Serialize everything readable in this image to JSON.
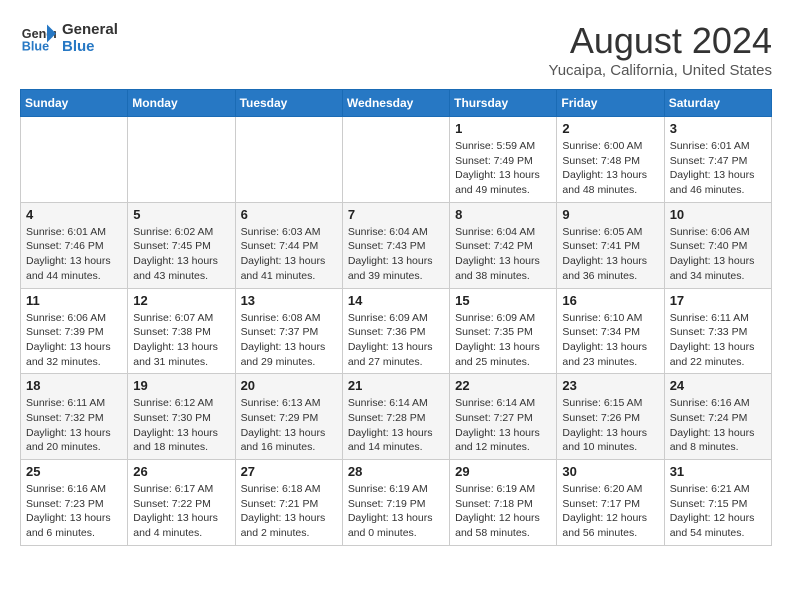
{
  "logo": {
    "line1": "General",
    "line2": "Blue"
  },
  "title": "August 2024",
  "subtitle": "Yucaipa, California, United States",
  "days_of_week": [
    "Sunday",
    "Monday",
    "Tuesday",
    "Wednesday",
    "Thursday",
    "Friday",
    "Saturday"
  ],
  "weeks": [
    [
      {
        "day": "",
        "info": ""
      },
      {
        "day": "",
        "info": ""
      },
      {
        "day": "",
        "info": ""
      },
      {
        "day": "",
        "info": ""
      },
      {
        "day": "1",
        "info": "Sunrise: 5:59 AM\nSunset: 7:49 PM\nDaylight: 13 hours\nand 49 minutes."
      },
      {
        "day": "2",
        "info": "Sunrise: 6:00 AM\nSunset: 7:48 PM\nDaylight: 13 hours\nand 48 minutes."
      },
      {
        "day": "3",
        "info": "Sunrise: 6:01 AM\nSunset: 7:47 PM\nDaylight: 13 hours\nand 46 minutes."
      }
    ],
    [
      {
        "day": "4",
        "info": "Sunrise: 6:01 AM\nSunset: 7:46 PM\nDaylight: 13 hours\nand 44 minutes."
      },
      {
        "day": "5",
        "info": "Sunrise: 6:02 AM\nSunset: 7:45 PM\nDaylight: 13 hours\nand 43 minutes."
      },
      {
        "day": "6",
        "info": "Sunrise: 6:03 AM\nSunset: 7:44 PM\nDaylight: 13 hours\nand 41 minutes."
      },
      {
        "day": "7",
        "info": "Sunrise: 6:04 AM\nSunset: 7:43 PM\nDaylight: 13 hours\nand 39 minutes."
      },
      {
        "day": "8",
        "info": "Sunrise: 6:04 AM\nSunset: 7:42 PM\nDaylight: 13 hours\nand 38 minutes."
      },
      {
        "day": "9",
        "info": "Sunrise: 6:05 AM\nSunset: 7:41 PM\nDaylight: 13 hours\nand 36 minutes."
      },
      {
        "day": "10",
        "info": "Sunrise: 6:06 AM\nSunset: 7:40 PM\nDaylight: 13 hours\nand 34 minutes."
      }
    ],
    [
      {
        "day": "11",
        "info": "Sunrise: 6:06 AM\nSunset: 7:39 PM\nDaylight: 13 hours\nand 32 minutes."
      },
      {
        "day": "12",
        "info": "Sunrise: 6:07 AM\nSunset: 7:38 PM\nDaylight: 13 hours\nand 31 minutes."
      },
      {
        "day": "13",
        "info": "Sunrise: 6:08 AM\nSunset: 7:37 PM\nDaylight: 13 hours\nand 29 minutes."
      },
      {
        "day": "14",
        "info": "Sunrise: 6:09 AM\nSunset: 7:36 PM\nDaylight: 13 hours\nand 27 minutes."
      },
      {
        "day": "15",
        "info": "Sunrise: 6:09 AM\nSunset: 7:35 PM\nDaylight: 13 hours\nand 25 minutes."
      },
      {
        "day": "16",
        "info": "Sunrise: 6:10 AM\nSunset: 7:34 PM\nDaylight: 13 hours\nand 23 minutes."
      },
      {
        "day": "17",
        "info": "Sunrise: 6:11 AM\nSunset: 7:33 PM\nDaylight: 13 hours\nand 22 minutes."
      }
    ],
    [
      {
        "day": "18",
        "info": "Sunrise: 6:11 AM\nSunset: 7:32 PM\nDaylight: 13 hours\nand 20 minutes."
      },
      {
        "day": "19",
        "info": "Sunrise: 6:12 AM\nSunset: 7:30 PM\nDaylight: 13 hours\nand 18 minutes."
      },
      {
        "day": "20",
        "info": "Sunrise: 6:13 AM\nSunset: 7:29 PM\nDaylight: 13 hours\nand 16 minutes."
      },
      {
        "day": "21",
        "info": "Sunrise: 6:14 AM\nSunset: 7:28 PM\nDaylight: 13 hours\nand 14 minutes."
      },
      {
        "day": "22",
        "info": "Sunrise: 6:14 AM\nSunset: 7:27 PM\nDaylight: 13 hours\nand 12 minutes."
      },
      {
        "day": "23",
        "info": "Sunrise: 6:15 AM\nSunset: 7:26 PM\nDaylight: 13 hours\nand 10 minutes."
      },
      {
        "day": "24",
        "info": "Sunrise: 6:16 AM\nSunset: 7:24 PM\nDaylight: 13 hours\nand 8 minutes."
      }
    ],
    [
      {
        "day": "25",
        "info": "Sunrise: 6:16 AM\nSunset: 7:23 PM\nDaylight: 13 hours\nand 6 minutes."
      },
      {
        "day": "26",
        "info": "Sunrise: 6:17 AM\nSunset: 7:22 PM\nDaylight: 13 hours\nand 4 minutes."
      },
      {
        "day": "27",
        "info": "Sunrise: 6:18 AM\nSunset: 7:21 PM\nDaylight: 13 hours\nand 2 minutes."
      },
      {
        "day": "28",
        "info": "Sunrise: 6:19 AM\nSunset: 7:19 PM\nDaylight: 13 hours\nand 0 minutes."
      },
      {
        "day": "29",
        "info": "Sunrise: 6:19 AM\nSunset: 7:18 PM\nDaylight: 12 hours\nand 58 minutes."
      },
      {
        "day": "30",
        "info": "Sunrise: 6:20 AM\nSunset: 7:17 PM\nDaylight: 12 hours\nand 56 minutes."
      },
      {
        "day": "31",
        "info": "Sunrise: 6:21 AM\nSunset: 7:15 PM\nDaylight: 12 hours\nand 54 minutes."
      }
    ]
  ]
}
